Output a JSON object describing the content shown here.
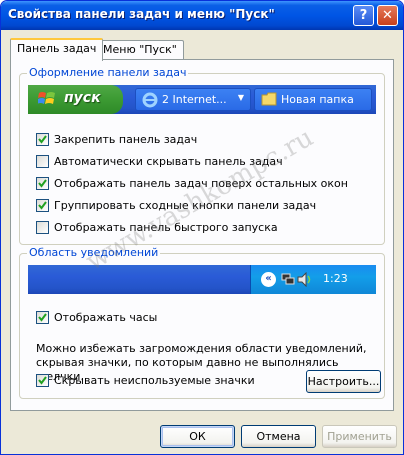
{
  "window": {
    "title": "Свойства панели задач и меню \"Пуск\"",
    "help_glyph": "?",
    "close_glyph": "✕"
  },
  "tabs": [
    {
      "label": "Панель задач",
      "active": true
    },
    {
      "label": "Меню \"Пуск\"",
      "active": false
    }
  ],
  "taskbar_group": {
    "legend": "Оформление панели задач",
    "preview": {
      "start_label": "пуск",
      "ie_button_label": "2 Internet...",
      "folder_button_label": "Новая папка"
    },
    "options": [
      {
        "label": "Закрепить панель задач",
        "checked": true
      },
      {
        "label": "Автоматически скрывать панель задач",
        "checked": false
      },
      {
        "label": "Отображать панель задач поверх остальных окон",
        "checked": true
      },
      {
        "label": "Группировать сходные кнопки панели задач",
        "checked": true
      },
      {
        "label": "Отображать панель быстрого запуска",
        "checked": false
      }
    ]
  },
  "tray_group": {
    "legend": "Область уведомлений",
    "preview": {
      "chevron_glyph": "«",
      "time": "1:23"
    },
    "show_clock": {
      "label": "Отображать часы",
      "checked": true
    },
    "description": "Можно избежать загромождения области уведомлений, скрывая значки, по которым давно не выполнялись щелчки.",
    "hide_icons": {
      "label": "Скрывать неиспользуемые значки",
      "checked": true
    },
    "configure_label": "Настроить..."
  },
  "buttons": {
    "ok": "ОК",
    "cancel": "Отмена",
    "apply": "Применить"
  },
  "watermark": "www.vashkompc.ru",
  "colors": {
    "title_bar": "#0055e5",
    "start_button": "#3c9a33",
    "legend_text": "#0046d5",
    "tray": "#139ee9"
  }
}
